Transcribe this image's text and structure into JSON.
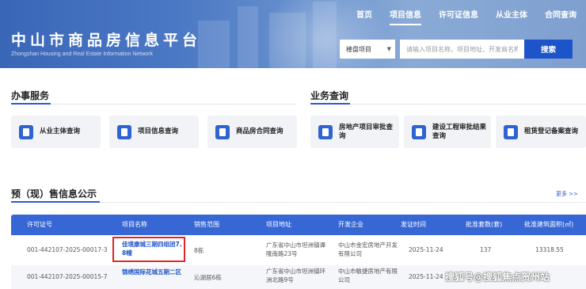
{
  "header": {
    "site_title": "中山市商品房信息平台",
    "site_subtitle": "Zhongshan Housing and Real Estate Information Network",
    "nav": [
      "首页",
      "项目信息",
      "许可证信息",
      "从业主体",
      "合同查询"
    ],
    "active_nav": "项目信息",
    "search": {
      "select_value": "楼盘项目",
      "placeholder": "请输入项目名称、项目地址、开发商名称",
      "button_label": "搜索"
    }
  },
  "services": {
    "title": "办事服务",
    "items": [
      {
        "label": "从业主体查询",
        "icon": "person-doc-icon"
      },
      {
        "label": "项目信息查询",
        "icon": "list-doc-icon"
      },
      {
        "label": "商品房合同查询",
        "icon": "contract-doc-icon"
      }
    ]
  },
  "business": {
    "title": "业务查询",
    "items": [
      {
        "label": "房地产项目审批查询",
        "icon": "approval-doc-icon"
      },
      {
        "label": "建设工程审批结果查询",
        "icon": "build-doc-icon"
      },
      {
        "label": "租赁登记备案查询",
        "icon": "lease-doc-icon"
      }
    ]
  },
  "presale": {
    "title": "预（现）售信息公示",
    "more_label": "更多 >>",
    "columns": [
      "许可证号",
      "项目名称",
      "销售范围",
      "项目地址",
      "开发企业",
      "发证时间",
      "批准套数(套)",
      "批准建筑面积(㎡)"
    ],
    "rows": [
      {
        "license": "001-442107-2025-00017-3",
        "project": "佳境康城三期四组团7、8幢",
        "scope": "8栋",
        "address": "广东省中山市坦洲镇谭隆南路23号",
        "developer": "中山市金宏房地产开发有限公司",
        "date": "2025-11-24",
        "units": "137",
        "area": "13318.55"
      },
      {
        "license": "001-442107-2025-00015-7",
        "project": "锦绣国际花城五期二区",
        "scope": "沁湖居6栋",
        "address": "广东省中山市坦洲镇环洲北路9号",
        "developer": "中山市敏捷房地产有限公司",
        "date": "2025-11-24",
        "units": "",
        "area": ""
      }
    ]
  },
  "watermark": "搜狐号@搜狐焦点贺州站",
  "colors": {
    "accent": "#2a5ad0",
    "table_header": "#3767d4",
    "highlight": "#e0262a"
  }
}
